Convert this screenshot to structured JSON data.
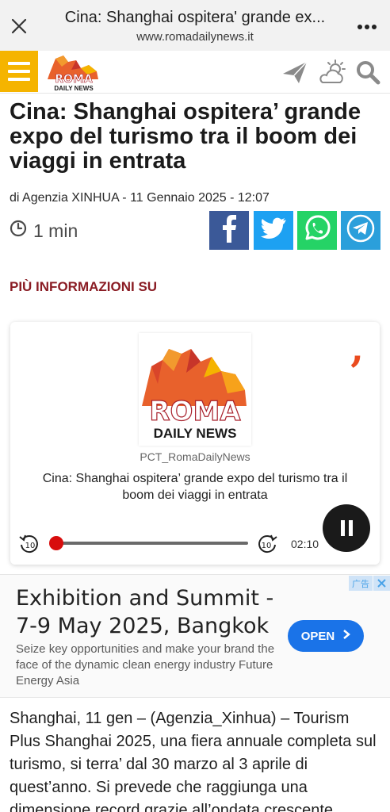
{
  "browser": {
    "title": "Cina: Shanghai ospitera' grande ex...",
    "url": "www.romadailynews.it",
    "close_icon": "close-icon",
    "menu_icon": "more-vertical-icon"
  },
  "header": {
    "logo_text_top": "ROMA",
    "logo_text_bottom": "DAILY NEWS",
    "icons": [
      "menu-icon",
      "send-icon",
      "weather-icon",
      "search-icon"
    ],
    "accent": "#f5b400"
  },
  "article": {
    "headline": "Cina: Shanghai ospitera’ grande expo del turismo tra il boom dei viaggi in entrata",
    "byline": "di Agenzia XINHUA - 11 Gennaio 2025 - 12:07",
    "read_time": "1 min",
    "more_info": "PIÙ INFORMAZIONI SU",
    "share": [
      {
        "name": "facebook",
        "color": "#3b5998"
      },
      {
        "name": "twitter",
        "color": "#1da1f2"
      },
      {
        "name": "whatsapp",
        "color": "#25d366"
      },
      {
        "name": "telegram",
        "color": "#2b9fdb"
      }
    ],
    "body": "Shanghai, 11 gen – (Agenzia_Xinhua) – Tourism Plus Shanghai 2025, una fiera annuale completa sul turismo, si terra’ dal 30 marzo al 3 aprile di quest’anno. Si prevede che raggiunga una dimensione record grazie all’ondata crescente"
  },
  "audio": {
    "logo_top": "ROMA",
    "logo_bottom": "DAILY NEWS",
    "source": "PCT_RomaDailyNews",
    "title": "Cina: Shanghai ospitera’ grande expo del turismo tra il boom dei viaggi in entrata",
    "rewind_label": "10",
    "forward_label": "10",
    "time_left": "02:10",
    "progress": 0,
    "state": "playing"
  },
  "ad": {
    "title": "Exhibition and Summit - 7-9 May 2025, Bangkok",
    "description": "Seize key opportunities and make your brand the face of the dynamic clean energy industry Future Energy Asia",
    "cta": "OPEN",
    "badge": "广告"
  }
}
